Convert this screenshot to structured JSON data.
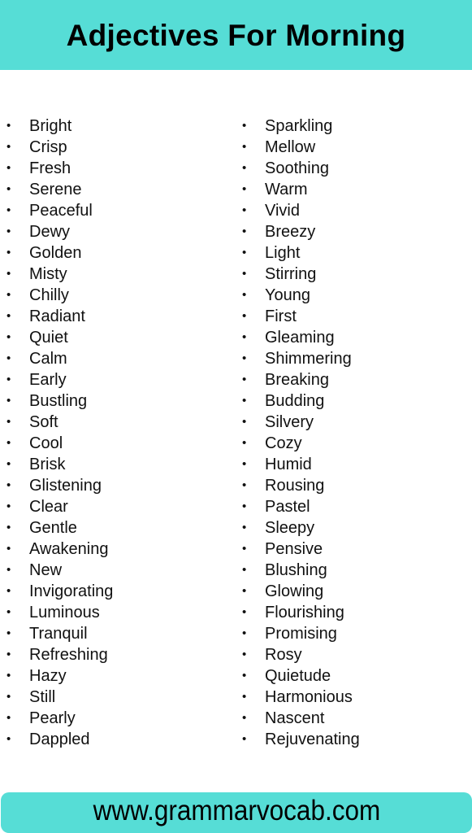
{
  "title": "Adjectives For Morning",
  "colors": {
    "accent": "#56ddd6",
    "text": "#000000",
    "background": "#ffffff"
  },
  "bullet_icon": "•",
  "left_column": [
    "Bright",
    "Crisp",
    "Fresh",
    "Serene",
    "Peaceful",
    "Dewy",
    "Golden",
    "Misty",
    "Chilly",
    "Radiant",
    "Quiet",
    "Calm",
    "Early",
    "Bustling",
    "Soft",
    "Cool",
    "Brisk",
    "Glistening",
    "Clear",
    "Gentle",
    "Awakening",
    "New",
    "Invigorating",
    "Luminous",
    "Tranquil",
    "Refreshing",
    "Hazy",
    "Still",
    "Pearly",
    "Dappled"
  ],
  "right_column": [
    "Sparkling",
    "Mellow",
    "Soothing",
    "Warm",
    "Vivid",
    "Breezy",
    "Light",
    "Stirring",
    "Young",
    "First",
    "Gleaming",
    "Shimmering",
    "Breaking",
    "Budding",
    "Silvery",
    "Cozy",
    "Humid",
    "Rousing",
    "Pastel",
    "Sleepy",
    "Pensive",
    "Blushing",
    "Glowing",
    "Flourishing",
    "Promising",
    "Rosy",
    "Quietude",
    "Harmonious",
    "Nascent",
    "Rejuvenating"
  ],
  "footer": {
    "url": "www.grammarvocab.com"
  }
}
